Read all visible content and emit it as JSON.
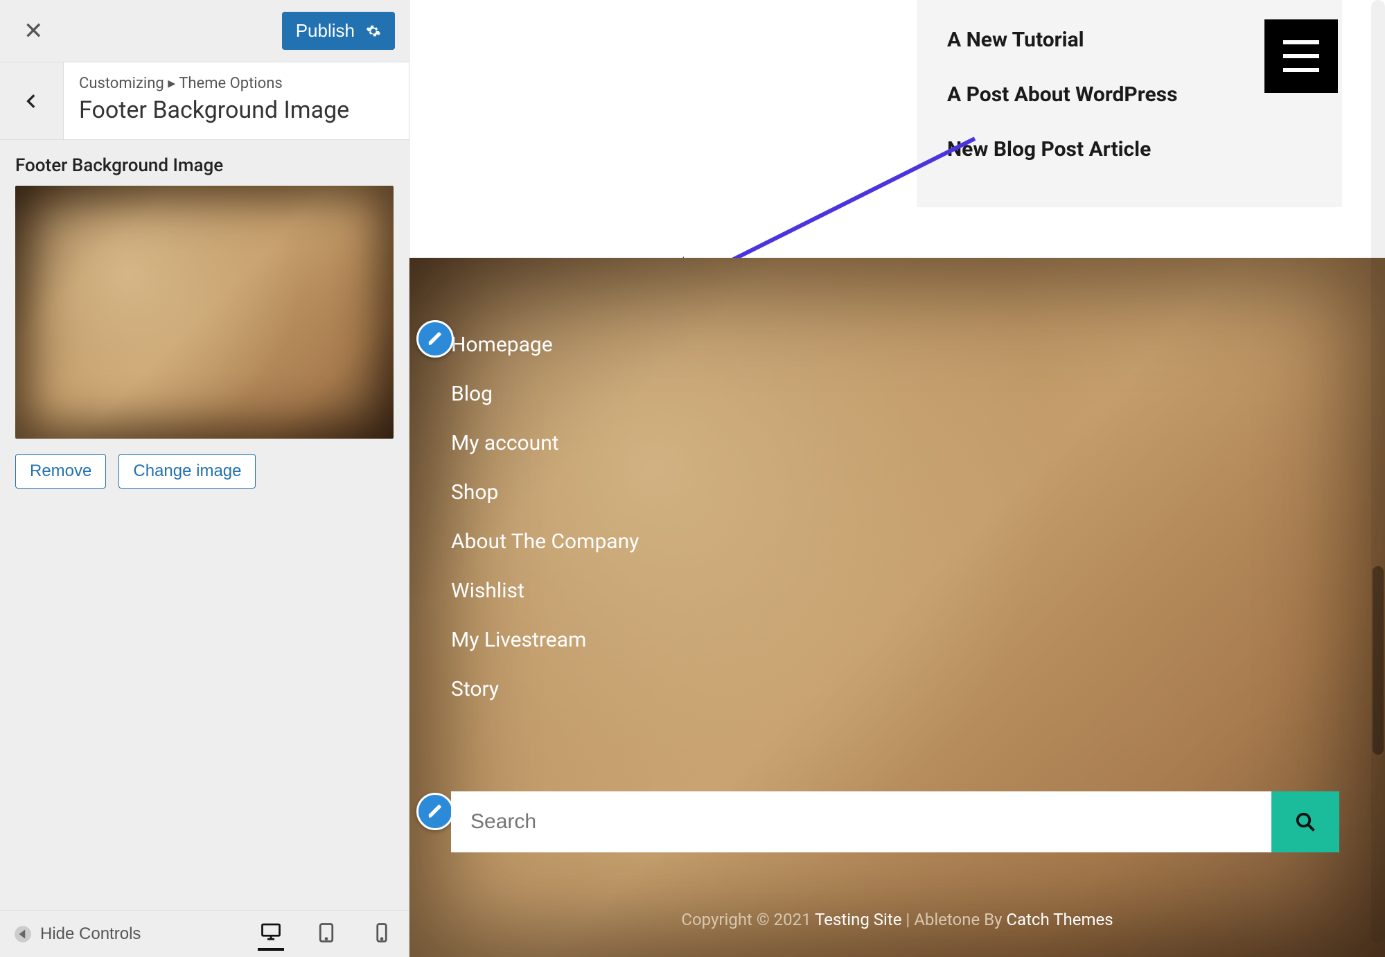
{
  "sidebar": {
    "publish_label": "Publish",
    "breadcrumb_root": "Customizing",
    "breadcrumb_parent": "Theme Options",
    "panel_title": "Footer Background Image",
    "field_label": "Footer Background Image",
    "remove_label": "Remove",
    "change_label": "Change image",
    "hide_controls_label": "Hide Controls"
  },
  "posts": [
    "A New Tutorial",
    "A Post About WordPress",
    "New Blog Post Article"
  ],
  "footer_links": [
    "Homepage",
    "Blog",
    "My account",
    "Shop",
    "About The Company",
    "Wishlist",
    "My Livestream",
    "Story"
  ],
  "search": {
    "placeholder": "Search"
  },
  "copyright": {
    "prefix": "Copyright © 2021 ",
    "site": "Testing Site",
    "mid": " | Abletone By ",
    "theme": "Catch Themes"
  },
  "colors": {
    "primary": "#2271b1",
    "accent": "#1abc9c",
    "arrow": "#4a34e0"
  }
}
